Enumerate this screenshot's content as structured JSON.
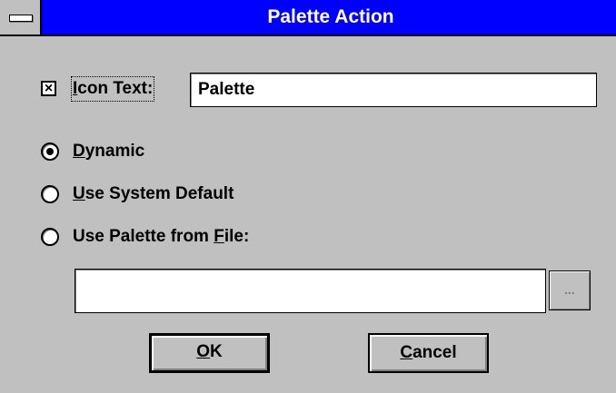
{
  "window": {
    "title": "Palette Action"
  },
  "icon_text": {
    "checked": true,
    "label_accel": "I",
    "label_rest": "con Text:",
    "value": "Palette"
  },
  "options": {
    "dynamic": {
      "accel": "D",
      "rest": "ynamic",
      "selected": true
    },
    "system_default": {
      "accel": "U",
      "rest": "se System Default",
      "selected": false
    },
    "from_file": {
      "prefix": "Use Palette from ",
      "accel": "F",
      "rest": "ile:",
      "selected": false
    }
  },
  "file_path": {
    "value": ""
  },
  "browse_button": {
    "label": "..."
  },
  "ok_button": {
    "accel": "O",
    "rest": "K"
  },
  "cancel_button": {
    "accel": "C",
    "rest": "ancel"
  },
  "colors": {
    "titlebar": "#0000ff",
    "face": "#c0c0c0"
  }
}
